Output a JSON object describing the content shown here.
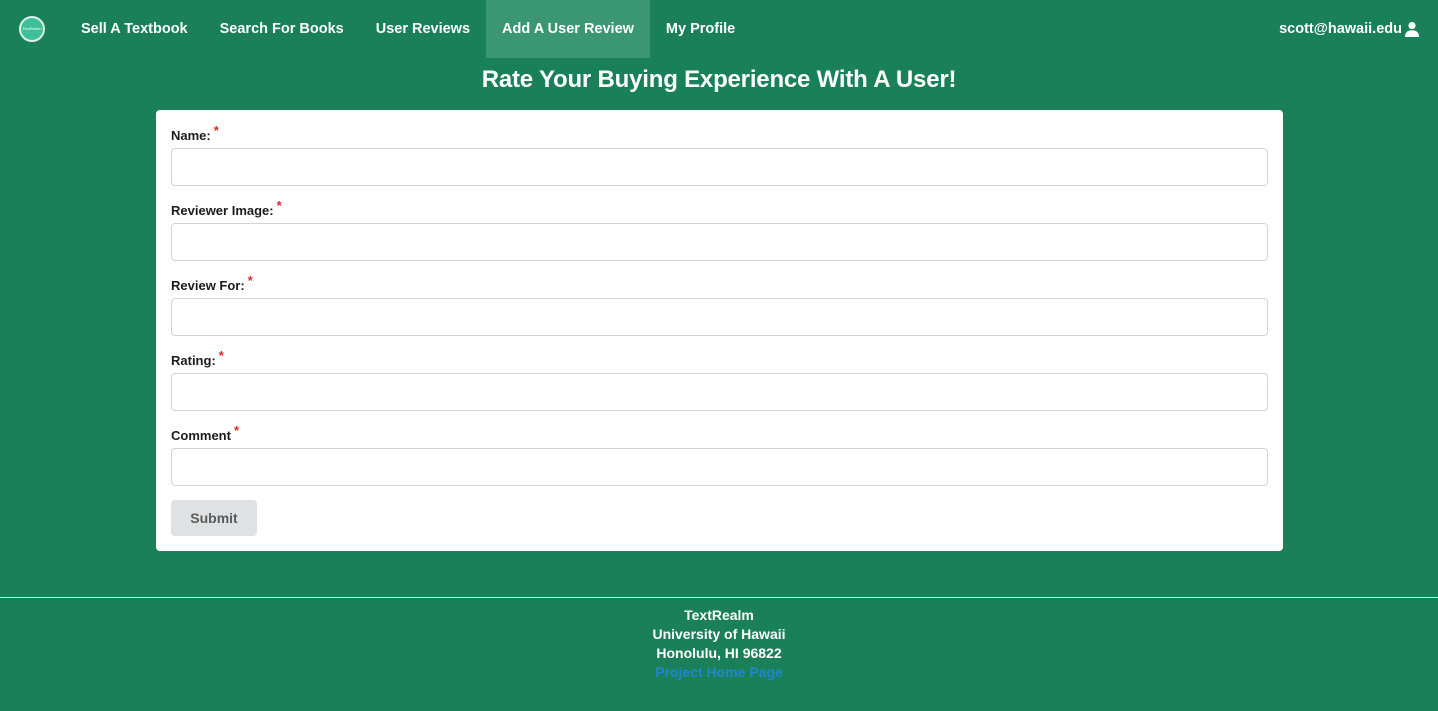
{
  "brand": {
    "logo_text": "TextRealm",
    "logo_subtext": "UH Manoa"
  },
  "nav": {
    "items": [
      {
        "label": "Sell A Textbook",
        "active": false
      },
      {
        "label": "Search For Books",
        "active": false
      },
      {
        "label": "User Reviews",
        "active": false
      },
      {
        "label": "Add A User Review",
        "active": true
      },
      {
        "label": "My Profile",
        "active": false
      }
    ],
    "user_email": "scott@hawaii.edu",
    "user_icon": "user-icon"
  },
  "page": {
    "title": "Rate Your Buying Experience With A User!"
  },
  "form": {
    "required_marker": "*",
    "fields": [
      {
        "label": "Name:",
        "value": "",
        "placeholder": ""
      },
      {
        "label": "Reviewer Image:",
        "value": "",
        "placeholder": ""
      },
      {
        "label": "Review For:",
        "value": "",
        "placeholder": ""
      },
      {
        "label": "Rating:",
        "value": "",
        "placeholder": ""
      },
      {
        "label": "Comment",
        "value": "",
        "placeholder": ""
      }
    ],
    "submit_label": "Submit"
  },
  "footer": {
    "lines": [
      "TextRealm",
      "University of Hawaii",
      "Honolulu, HI 96822"
    ],
    "link_label": "Project Home Page"
  },
  "colors": {
    "background": "#1a8059",
    "nav_active": "#3b9673",
    "required": "#db2828",
    "link": "#2185d0"
  }
}
